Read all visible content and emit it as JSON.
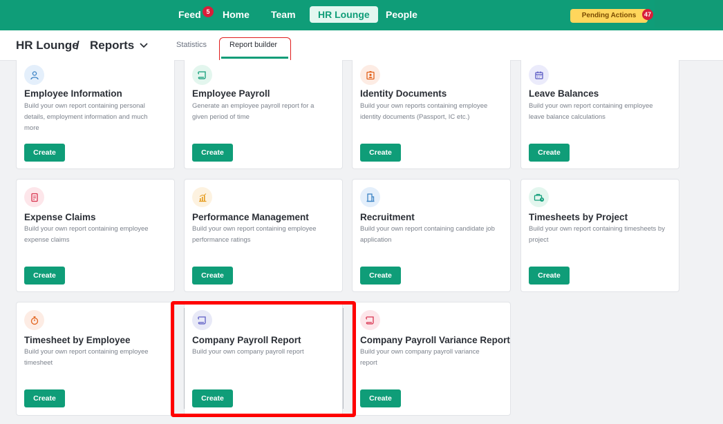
{
  "nav": {
    "items": [
      {
        "label": "Feed",
        "badge": "5"
      },
      {
        "label": "Home"
      },
      {
        "label": "Team"
      },
      {
        "label": "HR Lounge",
        "active": true
      },
      {
        "label": "People"
      }
    ],
    "pending_label": "Pending Actions",
    "pending_count": "47"
  },
  "breadcrumb": {
    "root": "HR Lounge",
    "sep": "/",
    "current": "Reports"
  },
  "tabs": [
    {
      "label": "Statistics"
    },
    {
      "label": "Report builder",
      "active": true
    }
  ],
  "colors": {
    "brand": "#0f9d78",
    "highlight": "#ff0000"
  },
  "cards": [
    {
      "title": "Employee Information",
      "desc": "Build your own report containing personal details, employment information and much more",
      "button": "Create",
      "icon": "user-icon"
    },
    {
      "title": "Employee Payroll",
      "desc": "Generate an employee payroll report for a given period of time",
      "button": "Create",
      "icon": "scroll-icon"
    },
    {
      "title": "Identity Documents",
      "desc": "Build your own reports containing employee identity documents (Passport, IC etc.)",
      "button": "Create",
      "icon": "id-badge-icon"
    },
    {
      "title": "Leave Balances",
      "desc": "Build your own report containing employee leave balance calculations",
      "button": "Create",
      "icon": "calendar-icon"
    },
    {
      "title": "Expense Claims",
      "desc": "Build your own report containing employee expense claims",
      "button": "Create",
      "icon": "receipt-icon"
    },
    {
      "title": "Performance Management",
      "desc": "Build your own report containing employee performance ratings",
      "button": "Create",
      "icon": "bar-chart-icon"
    },
    {
      "title": "Recruitment",
      "desc": "Build your own report containing candidate job application",
      "button": "Create",
      "icon": "building-icon"
    },
    {
      "title": "Timesheets by Project",
      "desc": "Build your own report containing timesheets by project",
      "button": "Create",
      "icon": "briefcase-clock-icon"
    },
    {
      "title": "Timesheet by Employee",
      "desc": "Build your own report containing employee timesheet",
      "button": "Create",
      "icon": "stopwatch-icon"
    },
    {
      "title": "Company Payroll Report",
      "desc": "Build your own company payroll report",
      "button": "Create",
      "icon": "scroll-icon"
    },
    {
      "title": "Company Payroll Variance Report",
      "desc": "Build your own company payroll variance report",
      "button": "Create",
      "icon": "scroll-icon"
    }
  ]
}
